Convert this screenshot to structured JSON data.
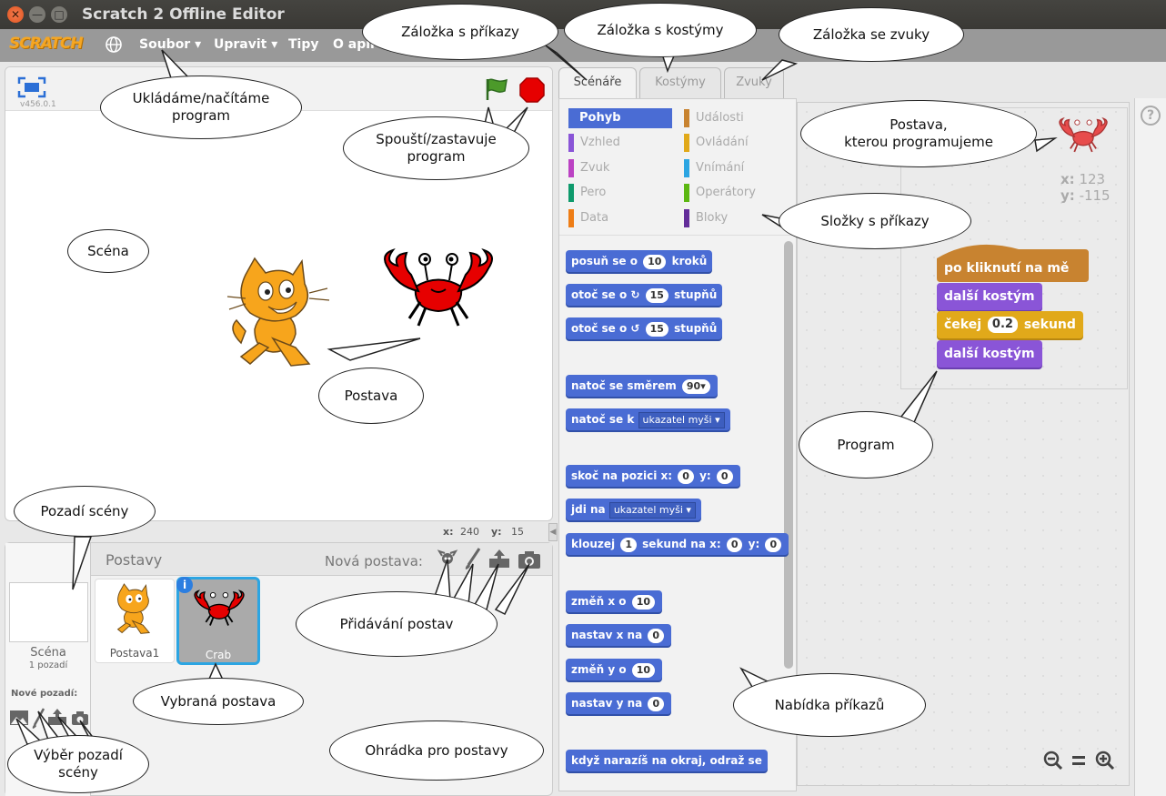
{
  "window": {
    "title": "Scratch 2 Offline Editor"
  },
  "menu": {
    "logo": "SCRATCH",
    "file": "Soubor ▾",
    "edit": "Upravit ▾",
    "tips": "Tipy",
    "about": "O apli"
  },
  "stage": {
    "version": "v456.0.1",
    "x_label": "x:",
    "x_value": "240",
    "y_label": "y:",
    "y_value": "15"
  },
  "sprites": {
    "header": "Postavy",
    "new_sprite_label": "Nová postava:",
    "items": [
      {
        "name": "Postava1"
      },
      {
        "name": "Crab"
      }
    ],
    "stage_label": "Scéna",
    "stage_backdrops": "1 pozadí",
    "new_backdrop_label": "Nové pozadí:"
  },
  "tabs": [
    "Scénáře",
    "Kostýmy",
    "Zvuky"
  ],
  "categories": [
    {
      "label": "Pohyb",
      "color": "#4a6cd4"
    },
    {
      "label": "Události",
      "color": "#c88330"
    },
    {
      "label": "Vzhled",
      "color": "#8a55d7"
    },
    {
      "label": "Ovládání",
      "color": "#e1a91a"
    },
    {
      "label": "Zvuk",
      "color": "#bb42c3"
    },
    {
      "label": "Vnímání",
      "color": "#2ca5e2"
    },
    {
      "label": "Pero",
      "color": "#0e9a6c"
    },
    {
      "label": "Operátory",
      "color": "#5cb712"
    },
    {
      "label": "Data",
      "color": "#ee7d16"
    },
    {
      "label": "Bloky",
      "color": "#632d99"
    }
  ],
  "blocks": {
    "move_a": "posuň se o",
    "move_v": "10",
    "move_b": "kroků",
    "turn_r_a": "otoč se o",
    "turn_r_v": "15",
    "turn_r_b": "stupňů",
    "turn_l_a": "otoč se o",
    "turn_l_v": "15",
    "turn_l_b": "stupňů",
    "point_dir_a": "natoč se směrem",
    "point_dir_v": "90▾",
    "point_to_a": "natoč se k",
    "point_to_v": "ukazatel myši ▾",
    "goto_xy_a": "skoč na pozici x:",
    "goto_xy_x": "0",
    "goto_xy_b": "y:",
    "goto_xy_y": "0",
    "goto_a": "jdi na",
    "goto_v": "ukazatel myši ▾",
    "glide_a": "klouzej",
    "glide_v": "1",
    "glide_b": "sekund na x:",
    "glide_x": "0",
    "glide_c": "y:",
    "change_x_a": "změň x o",
    "change_x_v": "10",
    "set_x_a": "nastav x na",
    "set_x_v": "0",
    "change_y_a": "změň y o",
    "change_y_v": "10",
    "set_y_a": "nastav y na",
    "set_y_v": "0",
    "bounce": "když narazíš na okraj, odraž se"
  },
  "sprite_info": {
    "x_label": "x:",
    "x_value": "123",
    "y_label": "y:",
    "y_value": "-115"
  },
  "script": {
    "hat": "po kliknutí na mě",
    "next_costume_1": "další kostým",
    "wait_a": "čekej",
    "wait_v": "0.2",
    "wait_b": "sekund",
    "next_costume_2": "další kostým"
  },
  "callouts": {
    "save": "Ukládáme/načítáme\nprogram",
    "tab_scripts": "Záložka s  příkazy",
    "tab_costumes": "Záložka s kostýmy",
    "tab_sounds": "Záložka se zvuky",
    "sprite_programmed": "Postava,\nkterou programujeme",
    "run_stop": "Spouští/zastavuje\nprogram",
    "scene": "Scéna",
    "sprite": "Postava",
    "categories": "Složky s příkazy",
    "program": "Program",
    "backdrop": "Pozadí scény",
    "add_sprites": "Přidávání postav",
    "selected_sprite": "Vybraná postava",
    "palette": "Nabídka příkazů",
    "sprite_corral": "Ohrádka pro postavy",
    "backdrop_choice": "Výběr pozadí\nscény"
  },
  "colors": {
    "motion": "#4a6cd4",
    "events": "#c88330",
    "looks": "#8a55d7",
    "control": "#e1a91a",
    "stop": "#e60000",
    "flag": "#2e7d32",
    "selection": "#2ca5e2"
  }
}
